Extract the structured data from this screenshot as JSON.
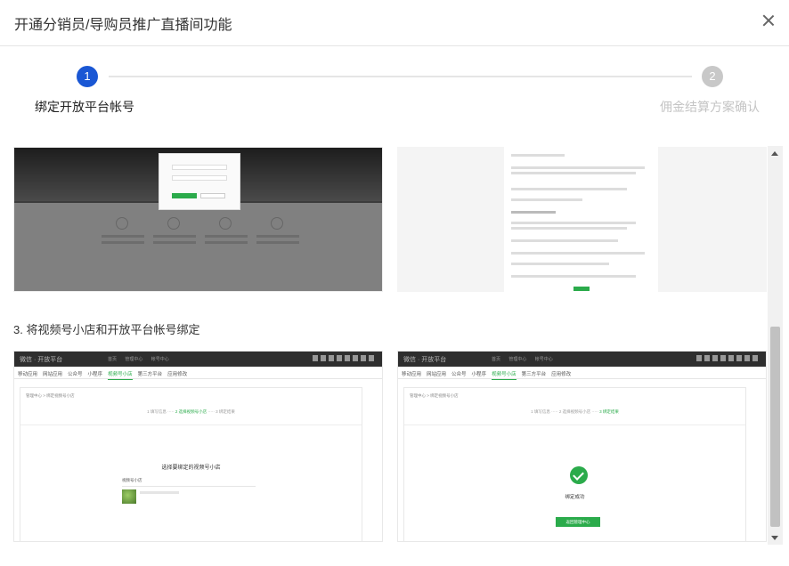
{
  "dialog": {
    "title": "开通分销员/导购员推广直播间功能"
  },
  "steps": [
    {
      "number": "1",
      "label": "绑定开放平台帐号",
      "active": true
    },
    {
      "number": "2",
      "label": "佣金结算方案确认",
      "active": false
    }
  ],
  "content": {
    "step3_caption": "3. 将视频号小店和开放平台帐号绑定"
  },
  "screens": {
    "platform_name": "微信 · 开放平台",
    "menu": "首页 管理中心 帐号中心",
    "subnav": [
      "移动应用",
      "网站应用",
      "公众号",
      "小程序",
      "视频号小店",
      "第三方平台",
      "应用修改"
    ],
    "subnav_active": "视频号小店",
    "breadcrumb": "管理中心 > 绑定视频号小店",
    "progress": [
      "1 填写信息",
      "2 选择视频号小店",
      "3 绑定结果"
    ],
    "pick_title": "选择要绑定的视频号小店",
    "pick_label": "视频号小店",
    "success_text": "绑定成功",
    "success_button": "返回管理中心"
  },
  "colors": {
    "primary": "#1a57d4",
    "inactive_step": "#c8c8c8",
    "wechat_green": "#2bab4b"
  }
}
